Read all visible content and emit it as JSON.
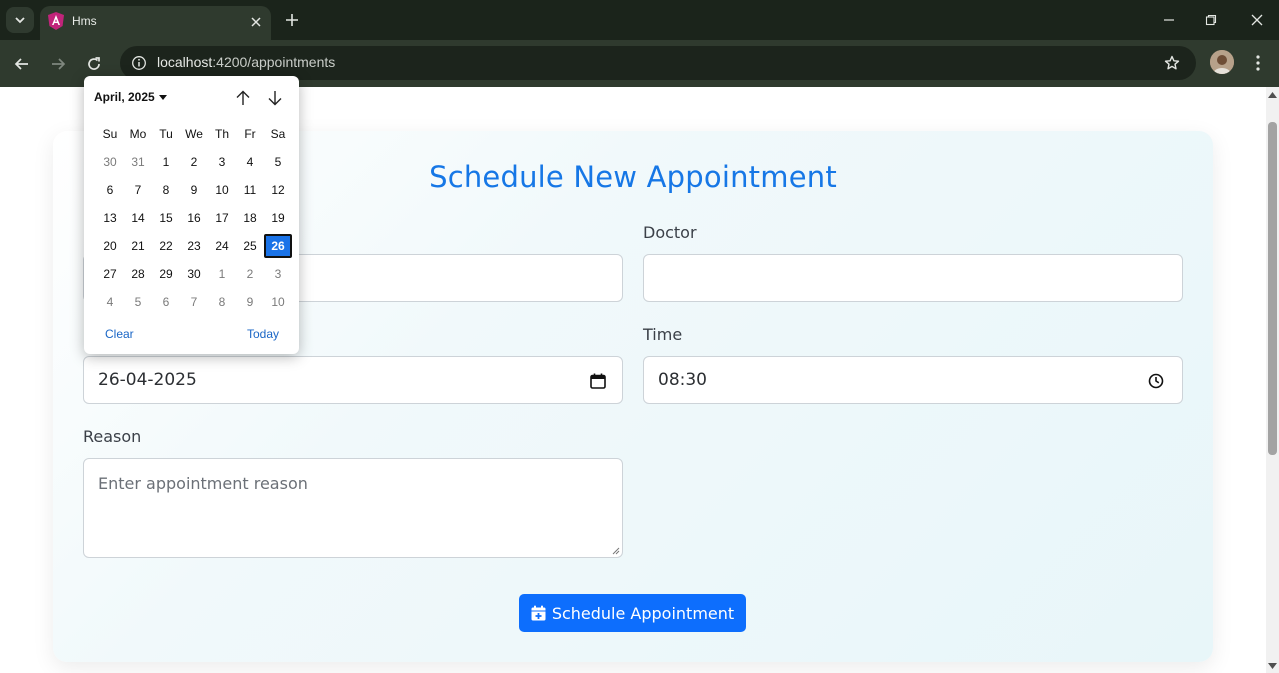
{
  "browser": {
    "tab_title": "Hms",
    "url_host": "localhost",
    "url_rest": ":4200/appointments"
  },
  "page": {
    "title": "Schedule New Appointment",
    "doctor_label": "Doctor",
    "time_label": "Time",
    "date_value": "26-04-2025",
    "time_value": "08:30",
    "reason_label": "Reason",
    "reason_placeholder": "Enter appointment reason",
    "submit_label": "Schedule Appointment"
  },
  "datepicker": {
    "month_label": "April, 2025",
    "weekdays": [
      "Su",
      "Mo",
      "Tu",
      "We",
      "Th",
      "Fr",
      "Sa"
    ],
    "weeks": [
      [
        "30",
        "31",
        "1",
        "2",
        "3",
        "4",
        "5"
      ],
      [
        "6",
        "7",
        "8",
        "9",
        "10",
        "11",
        "12"
      ],
      [
        "13",
        "14",
        "15",
        "16",
        "17",
        "18",
        "19"
      ],
      [
        "20",
        "21",
        "22",
        "23",
        "24",
        "25",
        "26"
      ],
      [
        "27",
        "28",
        "29",
        "30",
        "1",
        "2",
        "3"
      ],
      [
        "4",
        "5",
        "6",
        "7",
        "8",
        "9",
        "10"
      ]
    ],
    "selected_day": "26",
    "clear_label": "Clear",
    "today_label": "Today"
  },
  "colors": {
    "accent": "#1677e6",
    "button": "#0d6efd",
    "selected_day": "#1a73e8"
  }
}
